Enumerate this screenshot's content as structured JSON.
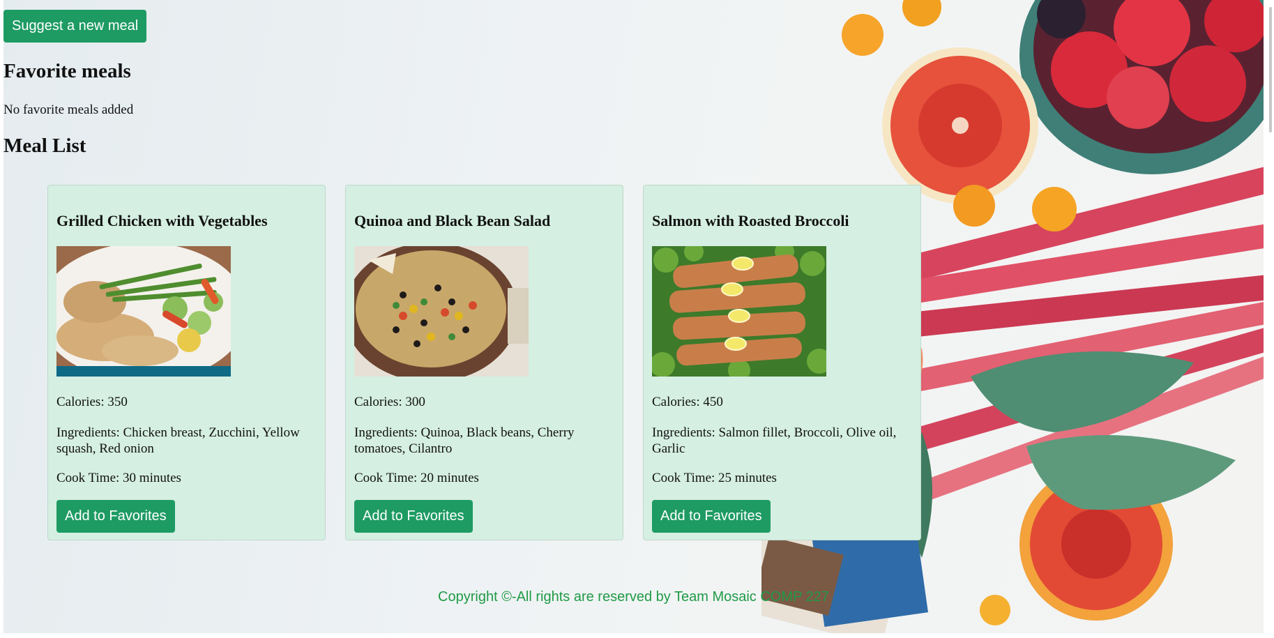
{
  "header": {
    "suggest_button": "Suggest a new meal"
  },
  "favorites": {
    "heading": "Favorite meals",
    "empty_text": "No favorite meals added"
  },
  "meal_list": {
    "heading": "Meal List",
    "meals": [
      {
        "title": "Grilled Chicken with Vegetables",
        "calories": "Calories: 350",
        "ingredients": "Ingredients: Chicken breast, Zucchini, Yellow squash, Red onion",
        "cook_time": "Cook Time: 30 minutes",
        "button": "Add to Favorites"
      },
      {
        "title": "Quinoa and Black Bean Salad",
        "calories": "Calories: 300",
        "ingredients": "Ingredients: Quinoa, Black beans, Cherry tomatoes, Cilantro",
        "cook_time": "Cook Time: 20 minutes",
        "button": "Add to Favorites"
      },
      {
        "title": "Salmon with Roasted Broccoli",
        "calories": "Calories: 450",
        "ingredients": "Ingredients: Salmon fillet, Broccoli, Olive oil, Garlic",
        "cook_time": "Cook Time: 25 minutes",
        "button": "Add to Favorites"
      }
    ]
  },
  "footer": {
    "text": "Copyright ©-All rights are reserved by Team Mosaic COMP 227"
  },
  "colors": {
    "accent": "#1e9b63",
    "card_bg": "#d5efe2",
    "footer_text": "#1f9a46"
  }
}
